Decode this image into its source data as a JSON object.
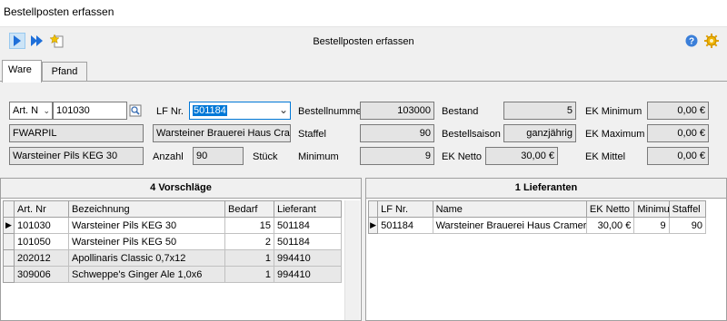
{
  "window": {
    "title": "Bestellposten erfassen"
  },
  "toolbar": {
    "title": "Bestellposten erfassen",
    "help_icon": "help-icon",
    "settings_icon": "gear-icon"
  },
  "tabs": [
    {
      "label": "Ware"
    },
    {
      "label": "Pfand"
    }
  ],
  "form": {
    "art_type": "Art. N",
    "art_nr": "101030",
    "lf_label": "LF Nr.",
    "lf_value": "501184",
    "short_name": "FWARPIL",
    "supplier_name": "Warsteiner Brauerei Haus Cramer",
    "description": "Warsteiner Pils KEG 30",
    "anzahl_label": "Anzahl",
    "anzahl_value": "90",
    "unit": "Stück",
    "bestellnummer_label": "Bestellnummer",
    "bestellnummer_value": "103000",
    "staffel_label": "Staffel",
    "staffel_value": "90",
    "minimum_label": "Minimum",
    "minimum_value": "9",
    "bestand_label": "Bestand",
    "bestand_value": "5",
    "saison_label": "Bestellsaison",
    "saison_value": "ganzjährig",
    "ek_netto_label": "EK Netto",
    "ek_netto_value": "30,00 €",
    "ek_min_label": "EK Minimum",
    "ek_min_value": "0,00 €",
    "ek_max_label": "EK Maximum",
    "ek_max_value": "0,00 €",
    "ek_mittel_label": "EK Mittel",
    "ek_mittel_value": "0,00 €"
  },
  "left_panel": {
    "title": "4 Vorschläge",
    "columns": [
      "Art. Nr",
      "Bezeichnung",
      "Bedarf",
      "Lieferant"
    ],
    "rows": [
      [
        "101030",
        "Warsteiner Pils KEG 30",
        "15",
        "501184"
      ],
      [
        "101050",
        "Warsteiner Pils KEG 50",
        "2",
        "501184"
      ],
      [
        "202012",
        "Apollinaris Classic 0,7x12",
        "1",
        "994410"
      ],
      [
        "309006",
        "Schweppe's Ginger Ale 1,0x6",
        "1",
        "994410"
      ]
    ]
  },
  "right_panel": {
    "title": "1 Lieferanten",
    "columns": [
      "LF Nr.",
      "Name",
      "EK Netto",
      "Minimum",
      "Staffel"
    ],
    "rows": [
      [
        "501184",
        "Warsteiner Brauerei Haus Cramer K",
        "30,00 €",
        "9",
        "90"
      ]
    ]
  }
}
